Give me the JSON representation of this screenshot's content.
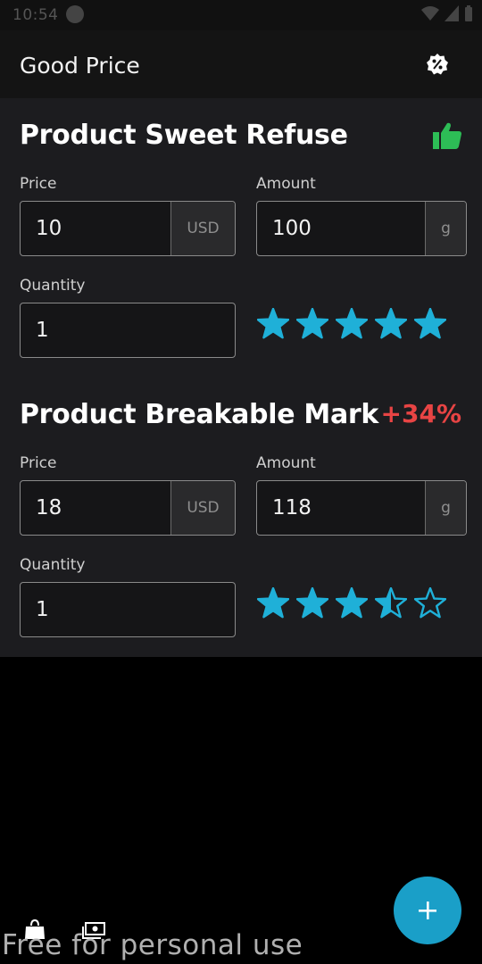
{
  "status_bar": {
    "time": "10:54"
  },
  "app_bar": {
    "title": "Good Price",
    "settings_icon": "discount-badge-icon"
  },
  "labels": {
    "price": "Price",
    "amount": "Amount",
    "quantity": "Quantity"
  },
  "products": [
    {
      "name": "Product Sweet Refuse",
      "price": "10",
      "price_unit": "USD",
      "amount": "100",
      "amount_unit": "g",
      "quantity": "1",
      "rating": 5,
      "badge_icon": "thumbs-up-icon",
      "badge_color": "#2dbd56"
    },
    {
      "name": "Product Breakable Mark",
      "price": "18",
      "price_unit": "USD",
      "amount": "118",
      "amount_unit": "g",
      "quantity": "1",
      "rating": 3.5,
      "price_difference": "+34%",
      "badge_color": "#e84444"
    }
  ],
  "colors": {
    "star": "#1fb0d8",
    "fab": "#1a9fc8",
    "accent_green": "#2dbd56",
    "accent_red": "#e84444"
  },
  "bottom_icons": [
    "shopping-bag-icon",
    "money-icon"
  ],
  "fab": {
    "icon": "plus-icon"
  },
  "watermark": "Free for personal use"
}
